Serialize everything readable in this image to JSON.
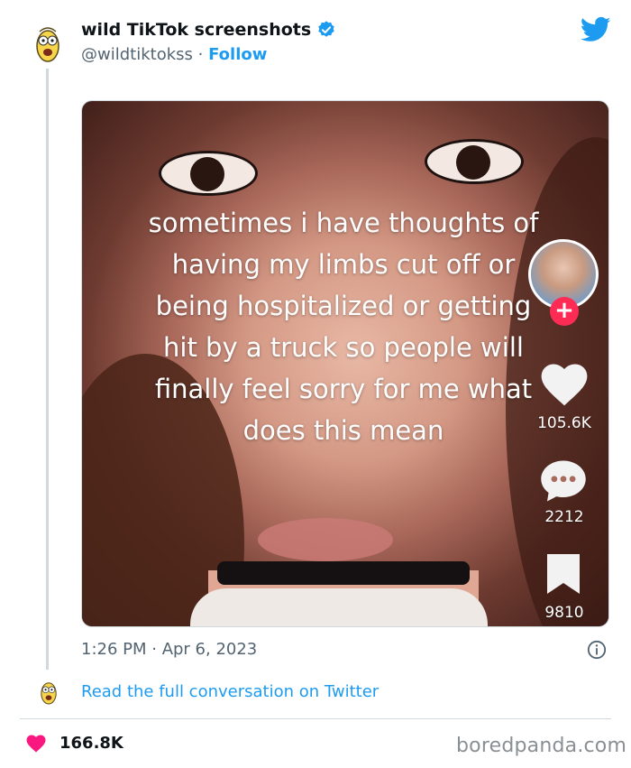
{
  "tweet": {
    "author_name": "wild TikTok screenshots",
    "handle": "@wildtiktokss",
    "separator": "·",
    "follow_label": "Follow",
    "timestamp": "1:26 PM · Apr 6, 2023",
    "read_more_label": "Read the full conversation on Twitter"
  },
  "media": {
    "caption": "sometimes i have thoughts of having my limbs cut off or being hospitalized or getting hit by a truck so people will finally feel sorry for me what does this mean",
    "plus_label": "+",
    "likes_count": "105.6K",
    "comments_count": "2212",
    "saves_count": "9810"
  },
  "footer": {
    "likes": "166.8K",
    "brand": "boredpanda.com"
  },
  "icons": {
    "verified": "verified-badge-icon",
    "twitter": "twitter-bird-icon",
    "info": "info-icon",
    "heart": "heart-icon"
  },
  "colors": {
    "twitter_blue": "#1d9bf0",
    "tiktok_red": "#fe2c55",
    "like_pink": "#f91880"
  }
}
